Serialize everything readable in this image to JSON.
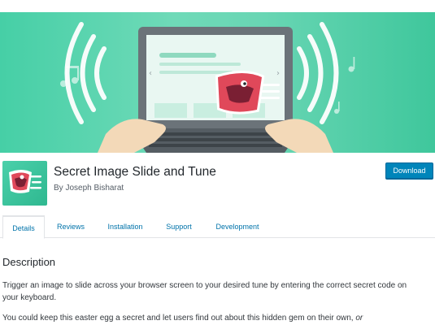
{
  "plugin": {
    "title": "Secret Image Slide and Tune",
    "author": "By Joseph Bisharat",
    "download_label": "Download"
  },
  "tabs": [
    {
      "label": "Details",
      "active": true
    },
    {
      "label": "Reviews",
      "active": false
    },
    {
      "label": "Installation",
      "active": false
    },
    {
      "label": "Support",
      "active": false
    },
    {
      "label": "Development",
      "active": false
    }
  ],
  "description": {
    "heading": "Description",
    "paragraph1": "Trigger an image to slide across your browser screen to your desired tune by entering the correct secret code on your keyboard.",
    "paragraph2": "You could keep this easter egg a secret and let users find out about this hidden gem on their own,",
    "paragraph2_trailing": "or"
  },
  "colors": {
    "banner_green": "#5fd6b1",
    "button_blue": "#0085ba",
    "link_blue": "#0073aa",
    "mascot_red": "#e0485a"
  }
}
